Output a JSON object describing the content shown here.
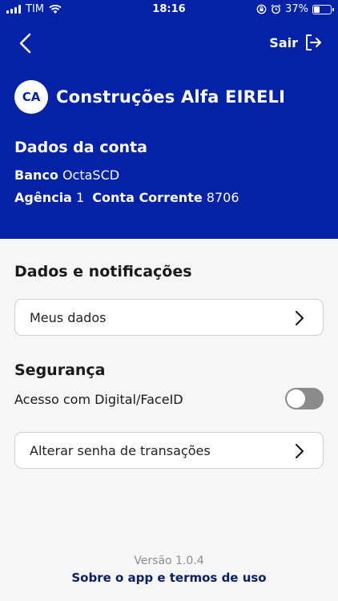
{
  "status_bar": {
    "carrier": "TIM",
    "time": "18:16",
    "battery_percent": "37%",
    "battery_level": 0.37
  },
  "header": {
    "back_icon": "chevron-left-icon",
    "logout_label": "Sair",
    "logout_icon": "logout-icon",
    "avatar_initials": "CA",
    "company_name": "Construções Alfa EIRELI",
    "background_color": "#0322a8"
  },
  "account": {
    "title": "Dados da conta",
    "bank_label": "Banco",
    "bank_value": "OctaSCD",
    "agency_label": "Agência",
    "agency_value": "1",
    "account_label": "Conta Corrente",
    "account_value": "8706"
  },
  "data_section": {
    "title": "Dados e notificações",
    "my_data_label": "Meus dados"
  },
  "security_section": {
    "title": "Segurança",
    "biometric_label": "Acesso com Digital/FaceID",
    "biometric_enabled": false,
    "change_password_label": "Alterar senha de transações"
  },
  "footer": {
    "version": "Versão 1.0.4",
    "about_link": "Sobre o app e termos de uso"
  }
}
